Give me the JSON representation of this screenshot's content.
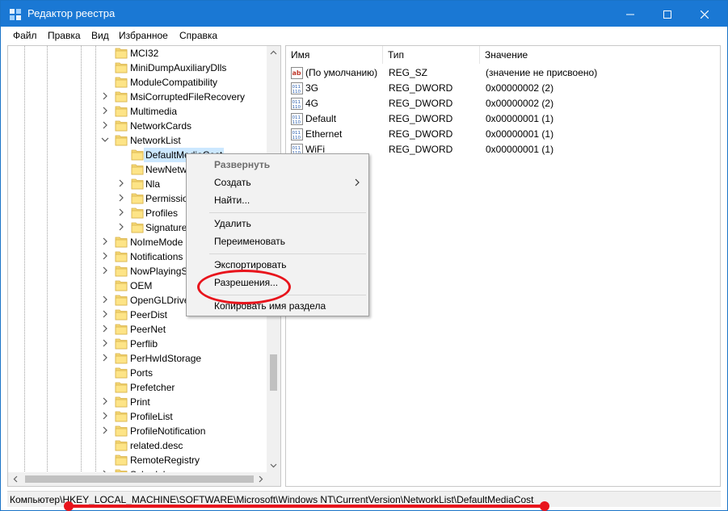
{
  "window": {
    "title": "Редактор реестра",
    "accent": "#1a78d4"
  },
  "menu": [
    "Файл",
    "Правка",
    "Вид",
    "Избранное",
    "Справка"
  ],
  "tree": {
    "items": [
      {
        "label": "MCI32",
        "expander": "none",
        "level": 1
      },
      {
        "label": "MiniDumpAuxiliaryDlls",
        "expander": "none",
        "level": 1
      },
      {
        "label": "ModuleCompatibility",
        "expander": "none",
        "level": 1
      },
      {
        "label": "MsiCorruptedFileRecovery",
        "expander": "collapsed",
        "level": 1
      },
      {
        "label": "Multimedia",
        "expander": "collapsed",
        "level": 1
      },
      {
        "label": "NetworkCards",
        "expander": "collapsed",
        "level": 1
      },
      {
        "label": "NetworkList",
        "expander": "expanded",
        "level": 1
      },
      {
        "label": "DefaultMediaCost",
        "expander": "none",
        "level": 2,
        "selected": true
      },
      {
        "label": "NewNetw",
        "expander": "none",
        "level": 2
      },
      {
        "label": "Nla",
        "expander": "collapsed",
        "level": 2
      },
      {
        "label": "Permissio",
        "expander": "collapsed",
        "level": 2
      },
      {
        "label": "Profiles",
        "expander": "collapsed",
        "level": 2
      },
      {
        "label": "Signature",
        "expander": "collapsed",
        "level": 2
      },
      {
        "label": "NoImeMode",
        "expander": "collapsed",
        "level": 1
      },
      {
        "label": "Notifications",
        "expander": "collapsed",
        "level": 1
      },
      {
        "label": "NowPlayingS",
        "expander": "collapsed",
        "level": 1
      },
      {
        "label": "OEM",
        "expander": "none",
        "level": 1
      },
      {
        "label": "OpenGLDrive",
        "expander": "collapsed",
        "level": 1
      },
      {
        "label": "PeerDist",
        "expander": "collapsed",
        "level": 1
      },
      {
        "label": "PeerNet",
        "expander": "collapsed",
        "level": 1
      },
      {
        "label": "Perflib",
        "expander": "collapsed",
        "level": 1
      },
      {
        "label": "PerHwIdStorage",
        "expander": "collapsed",
        "level": 1
      },
      {
        "label": "Ports",
        "expander": "none",
        "level": 1
      },
      {
        "label": "Prefetcher",
        "expander": "none",
        "level": 1
      },
      {
        "label": "Print",
        "expander": "collapsed",
        "level": 1
      },
      {
        "label": "ProfileList",
        "expander": "collapsed",
        "level": 1
      },
      {
        "label": "ProfileNotification",
        "expander": "collapsed",
        "level": 1
      },
      {
        "label": "related.desc",
        "expander": "none",
        "level": 1
      },
      {
        "label": "RemoteRegistry",
        "expander": "none",
        "level": 1
      },
      {
        "label": "Schedule",
        "expander": "collapsed",
        "level": 1
      }
    ]
  },
  "values": {
    "columns": [
      "Имя",
      "Тип",
      "Значение"
    ],
    "rows": [
      {
        "icon": "string-value-icon",
        "name": "(По умолчанию)",
        "type": "REG_SZ",
        "data": "(значение не присвоено)"
      },
      {
        "icon": "binary-value-icon",
        "name": "3G",
        "type": "REG_DWORD",
        "data": "0x00000002 (2)"
      },
      {
        "icon": "binary-value-icon",
        "name": "4G",
        "type": "REG_DWORD",
        "data": "0x00000002 (2)"
      },
      {
        "icon": "binary-value-icon",
        "name": "Default",
        "type": "REG_DWORD",
        "data": "0x00000001 (1)"
      },
      {
        "icon": "binary-value-icon",
        "name": "Ethernet",
        "type": "REG_DWORD",
        "data": "0x00000001 (1)"
      },
      {
        "icon": "binary-value-icon",
        "name": "WiFi",
        "type": "REG_DWORD",
        "data": "0x00000001 (1)"
      }
    ]
  },
  "context_menu": {
    "expand": "Развернуть",
    "create": "Создать",
    "find": "Найти...",
    "delete": "Удалить",
    "rename": "Переименовать",
    "export": "Экспортировать",
    "permissions": "Разрешения...",
    "copy_key_name": "Копировать имя раздела"
  },
  "status": {
    "path": "Компьютер\\HKEY_LOCAL_MACHINE\\SOFTWARE\\Microsoft\\Windows NT\\CurrentVersion\\NetworkList\\DefaultMediaCost"
  },
  "annotation": {
    "color": "#e8141c"
  }
}
